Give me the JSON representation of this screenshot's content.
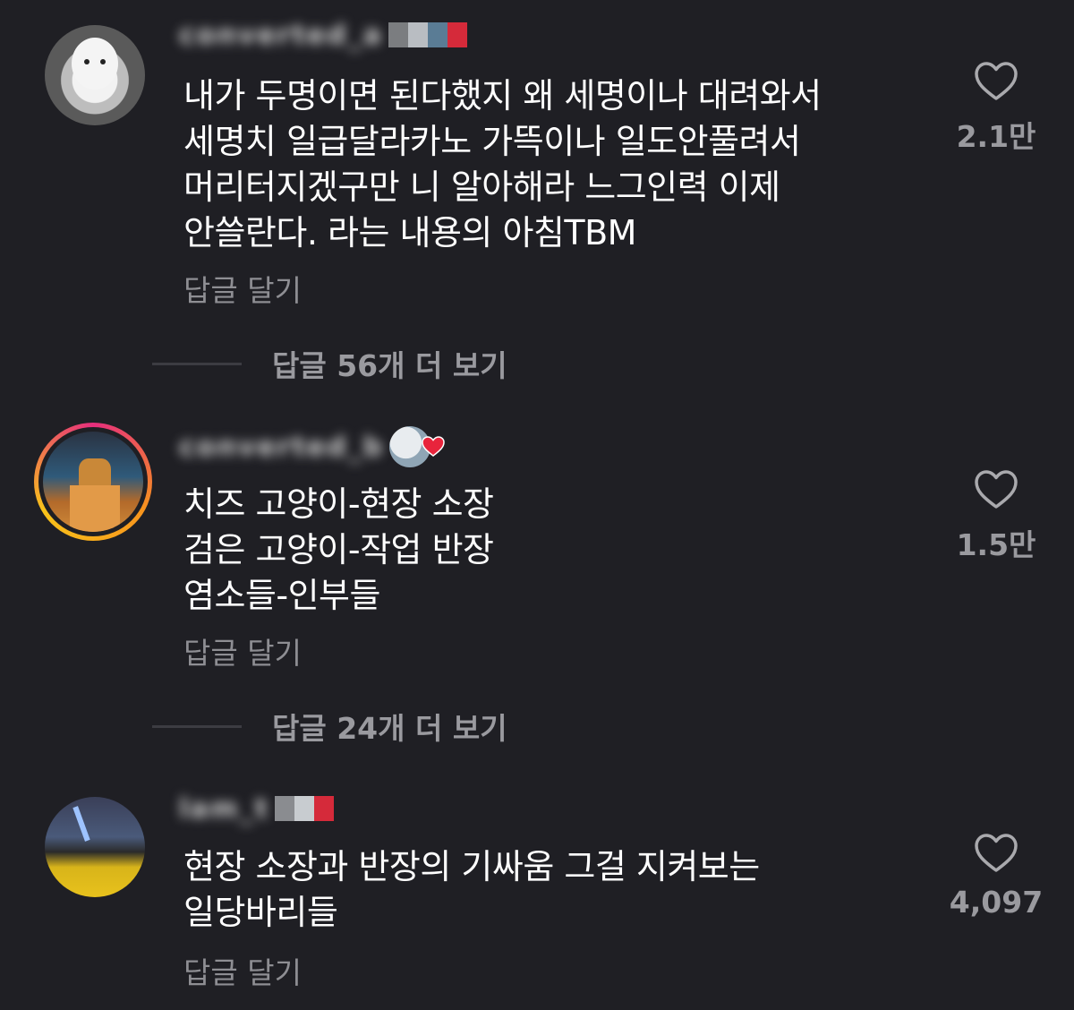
{
  "comments": [
    {
      "username": "converted_a",
      "text": "내가 두명이면 된다했지 왜 세명이나 대려와서\n세명치 일급달라카노 가뜩이나 일도안풀려서\n머리터지겠구만 니 알아해라 느그인력 이제\n안쓸란다. 라는 내용의 아침TBM",
      "reply_label": "답글 달기",
      "like_count": "2.1만",
      "more_replies": "답글 56개 더 보기"
    },
    {
      "username": "converted_b",
      "text": "치즈 고양이-현장 소장\n검은 고양이-작업 반장\n염소들-인부들",
      "reply_label": "답글 달기",
      "like_count": "1.5만",
      "more_replies": "답글 24개 더 보기"
    },
    {
      "username": "lam_t",
      "text": "현장 소장과 반장의 기싸움 그걸 지켜보는\n일당바리들",
      "reply_label": "답글 달기",
      "like_count": "4,097"
    }
  ],
  "colors": {
    "background": "#1f1f24",
    "text_primary": "#ffffff",
    "text_secondary": "#8e8e93",
    "heart_badge": "#e8243c"
  },
  "icons": {
    "like": "heart-outline-icon",
    "badge": "heart-badge-icon"
  }
}
